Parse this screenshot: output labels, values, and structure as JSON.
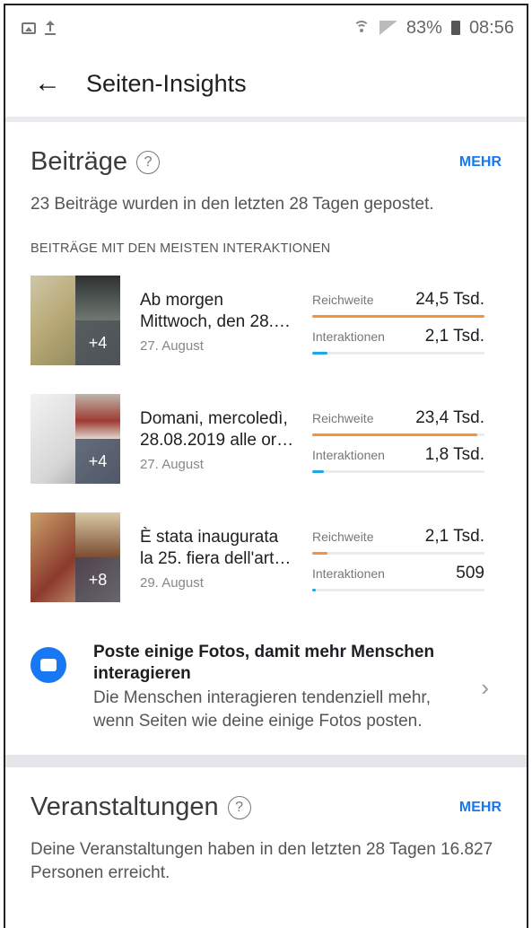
{
  "status_bar": {
    "battery": "83%",
    "time": "08:56"
  },
  "header": {
    "title": "Seiten-Insights"
  },
  "posts_section": {
    "title": "Beiträge",
    "help": "?",
    "more": "MEHR",
    "description": "23 Beiträge wurden in den letzten 28 Tagen gepostet.",
    "list_label": "BEITRÄGE MIT DEN MEISTEN INTERAKTIONEN",
    "posts": [
      {
        "title_line1": "Ab morgen",
        "title_line2": "Mittwoch, den 28.…",
        "date": "27. August",
        "more_count": "+4",
        "reach_label": "Reichweite",
        "reach_value": "24,5 Tsd.",
        "reach_fill": 1.0,
        "inter_label": "Interaktionen",
        "inter_value": "2,1 Tsd.",
        "inter_fill": 0.09
      },
      {
        "title_line1": "Domani, mercoledì,",
        "title_line2": "28.08.2019 alle or…",
        "date": "27. August",
        "more_count": "+4",
        "reach_label": "Reichweite",
        "reach_value": "23,4 Tsd.",
        "reach_fill": 0.96,
        "inter_label": "Interaktionen",
        "inter_value": "1,8 Tsd.",
        "inter_fill": 0.07
      },
      {
        "title_line1": "È stata inaugurata",
        "title_line2": "la 25. fiera dell'art…",
        "date": "29. August",
        "more_count": "+8",
        "reach_label": "Reichweite",
        "reach_value": "2,1 Tsd.",
        "reach_fill": 0.09,
        "inter_label": "Interaktionen",
        "inter_value": "509",
        "inter_fill": 0.02
      }
    ],
    "tip": {
      "title": "Poste einige Fotos, damit mehr Menschen interagieren",
      "text": "Die Menschen interagieren tendenziell mehr, wenn Seiten wie deine einige Fotos posten."
    }
  },
  "events_section": {
    "title": "Veranstaltungen",
    "help": "?",
    "more": "MEHR",
    "description": "Deine Veranstaltungen haben in den letzten 28 Tagen 16.827 Personen erreicht."
  },
  "colors": {
    "accent": "#1877f2",
    "reach_bar": "#f7923a",
    "interactions_bar": "#1ea7e6"
  }
}
